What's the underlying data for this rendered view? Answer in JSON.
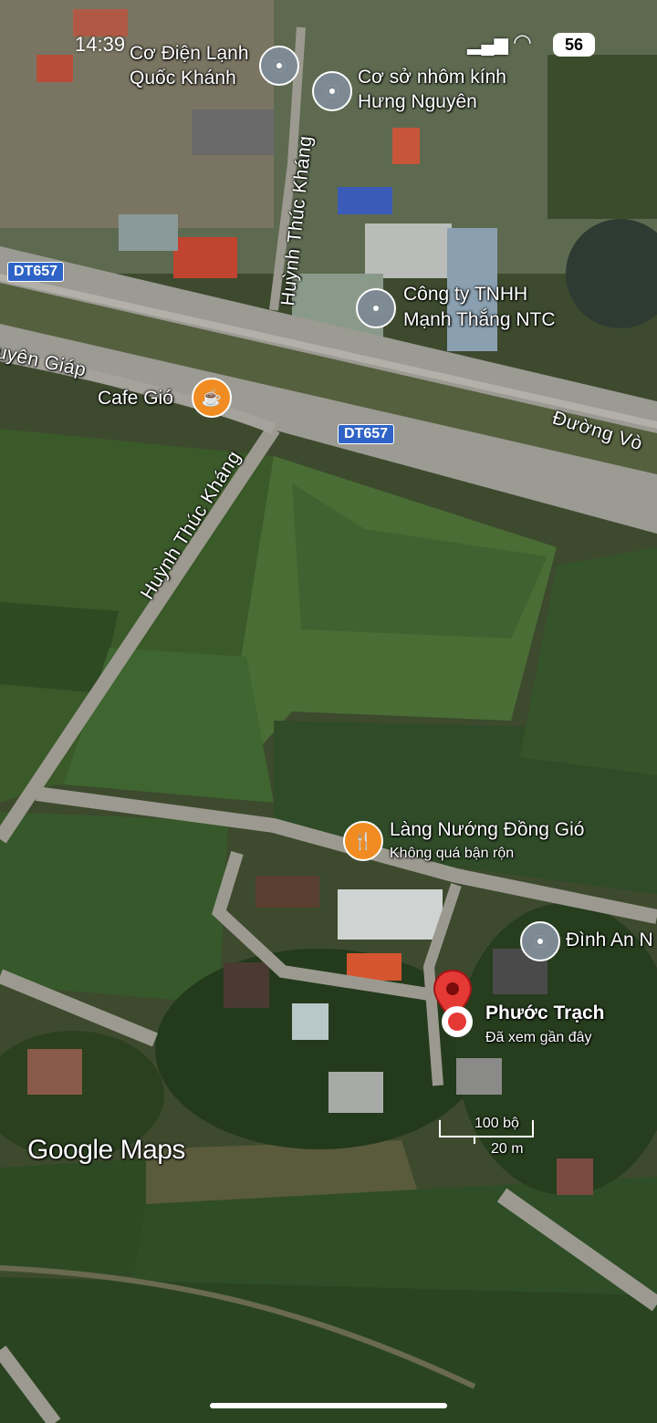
{
  "status_bar": {
    "time": "14:39",
    "battery": "56"
  },
  "road_shields": [
    {
      "text": "DT657"
    },
    {
      "text": "DT657"
    }
  ],
  "roads": {
    "huynh_thuc_khang_top": "Huỳnh Thúc Kháng",
    "huynh_thuc_khang_mid": "Huỳnh Thúc Kháng",
    "nguyen_giap": "uyên Giáp",
    "duong_vo": "Đường Vò"
  },
  "places": [
    {
      "name_line1": "Cơ Điện Lạnh",
      "name_line2": "Quốc Khánh",
      "icon": "location-pin-icon"
    },
    {
      "name_line1": "Cơ sở nhôm kính",
      "name_line2": "Hưng Nguyên",
      "icon": "location-pin-icon"
    },
    {
      "name_line1": "Công ty TNHH",
      "name_line2": "Mạnh Thắng NTC",
      "icon": "location-pin-icon"
    },
    {
      "name": "Cafe Gió",
      "icon": "coffee-icon"
    },
    {
      "name": "Làng Nướng Đồng Gió",
      "subtitle": "Không quá bận rộn",
      "icon": "restaurant-icon"
    },
    {
      "name": "Đình An N",
      "icon": "location-pin-icon"
    }
  ],
  "selected_place": {
    "name": "Phước Trạch",
    "subtitle": "Đã xem gần đây",
    "icon": "red-marker-icon"
  },
  "scale": {
    "imperial": "100 bộ",
    "metric": "20 m"
  },
  "brand": "Google Maps",
  "colors": {
    "shield": "#2f63c6",
    "marker_red": "#e53935",
    "poi_gray": "#7d8a93",
    "poi_orange": "#f08c21"
  }
}
